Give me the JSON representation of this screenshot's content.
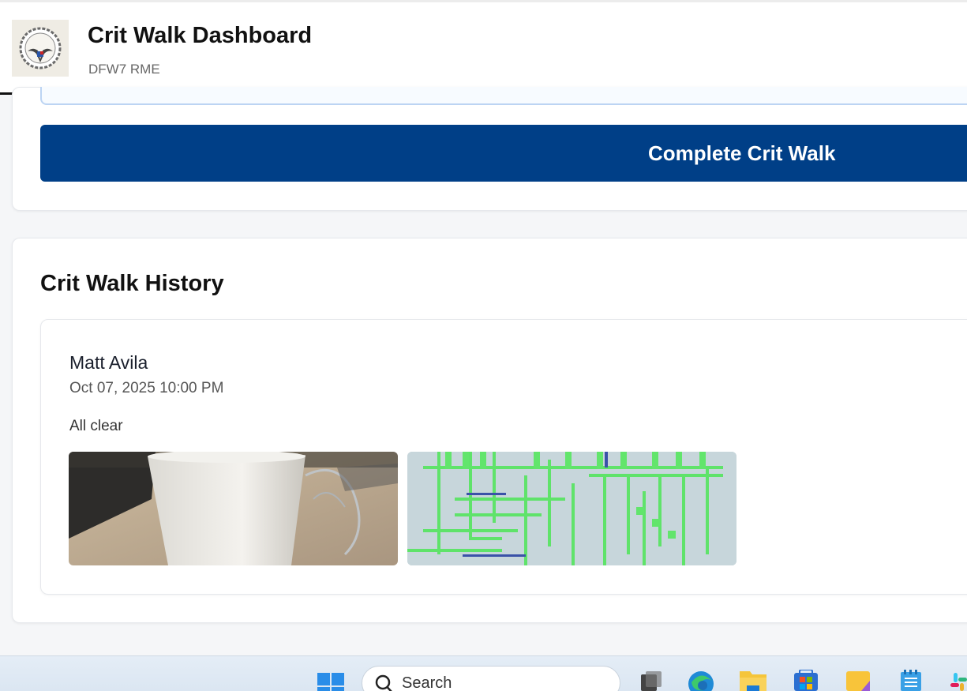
{
  "header": {
    "title": "Crit Walk Dashboard",
    "subtitle": "DFW7 RME",
    "logo_text": "DFW7 RME"
  },
  "actions": {
    "complete_label": "Complete Crit Walk"
  },
  "history": {
    "title": "Crit Walk History",
    "entries": [
      {
        "name": "Matt Avila",
        "date": "Oct 07, 2025 10:00 PM",
        "note": "All clear",
        "photos": [
          "cup-photo",
          "panel-photo"
        ]
      }
    ]
  },
  "taskbar": {
    "search_placeholder": "Search",
    "icons": [
      "windows-start-icon",
      "search-icon",
      "task-view-icon",
      "edge-icon",
      "file-explorer-icon",
      "store-icon",
      "sticky-notes-icon",
      "notepad-icon",
      "slack-icon"
    ]
  },
  "colors": {
    "primary_button": "#003f87",
    "background": "#f5f6f8"
  }
}
